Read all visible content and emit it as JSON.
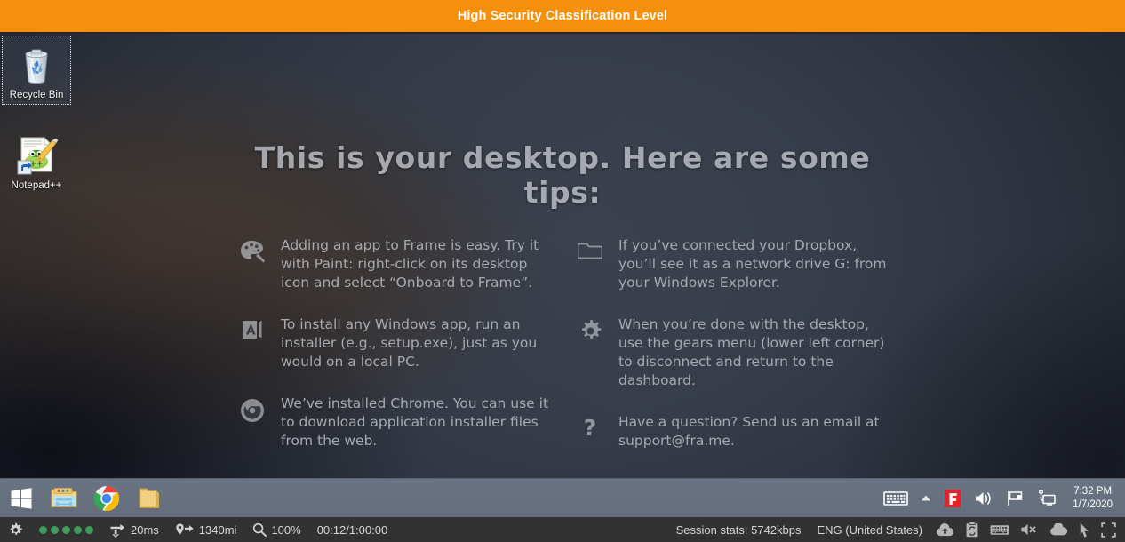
{
  "classification": {
    "label": "High Security Classification Level",
    "bg_color": "#f5900c",
    "text_color": "#ffffff"
  },
  "desktop": {
    "icons": [
      {
        "name": "recycle-bin",
        "label": "Recycle Bin",
        "selected": true
      },
      {
        "name": "notepadpp",
        "label": "Notepad++",
        "selected": false
      }
    ],
    "tips": {
      "heading": "This is your desktop. Here are some tips:",
      "left_column": [
        {
          "icon": "paint-palette-icon",
          "text": "Adding an app to Frame is easy. Try it with Paint: right-click on its desktop icon and select “Onboard to Frame”."
        },
        {
          "icon": "installer-app-icon",
          "text": "To install any Windows app, run an installer (e.g., setup.exe), just as you would on a local PC."
        },
        {
          "icon": "chrome-icon",
          "text": "We’ve installed Chrome. You can use it to download application installer files from the web."
        }
      ],
      "right_column": [
        {
          "icon": "folder-icon",
          "text": "If you’ve connected your Dropbox, you’ll see it as a network drive G: from your Windows Explorer."
        },
        {
          "icon": "gear-icon",
          "text": "When you’re done with the desktop, use the gears menu (lower left corner) to disconnect and return to the dashboard."
        },
        {
          "icon": "question-mark-icon",
          "text": "Have a question? Send us an email at support@fra.me."
        }
      ]
    }
  },
  "taskbar": {
    "start_label": "Start",
    "pinned": [
      {
        "name": "file-explorer-icon",
        "label": "File Explorer"
      },
      {
        "name": "chrome-icon",
        "label": "Google Chrome"
      },
      {
        "name": "folder-window-icon",
        "label": "File Explorer Window"
      }
    ],
    "tray": {
      "icons": [
        {
          "name": "touch-keyboard-icon",
          "label": "Touch keyboard"
        },
        {
          "name": "show-hidden-icons-icon",
          "label": "Show hidden icons"
        },
        {
          "name": "frame-app-icon",
          "label": "Frame",
          "color": "#e0232e"
        },
        {
          "name": "volume-icon",
          "label": "Volume"
        },
        {
          "name": "action-center-flag-icon",
          "label": "Action Center"
        },
        {
          "name": "network-monitor-icon",
          "label": "Network"
        }
      ],
      "clock": {
        "time": "7:32 PM",
        "date": "1/7/2020"
      }
    }
  },
  "statusbar": {
    "gear_label": "Session menu",
    "signal_dots": 5,
    "signal_color": "#3f9b5c",
    "latency": "20ms",
    "distance": "1340mi",
    "zoom": "100%",
    "session_time": "00:12/1:00:00",
    "session_stats": "Session stats: 5742kbps",
    "language": "ENG (United States)",
    "right_icons": [
      {
        "name": "cloud-upload-icon",
        "label": "Upload files"
      },
      {
        "name": "clipboard-sync-icon",
        "label": "Clipboard"
      },
      {
        "name": "keyboard-icon",
        "label": "Keyboard"
      },
      {
        "name": "mute-speaker-icon",
        "label": "Audio muted"
      },
      {
        "name": "cloud-icon",
        "label": "Cloud storage"
      },
      {
        "name": "cursor-arrow-icon",
        "label": "Mouse mode"
      },
      {
        "name": "fullscreen-icon",
        "label": "Fullscreen"
      }
    ]
  }
}
